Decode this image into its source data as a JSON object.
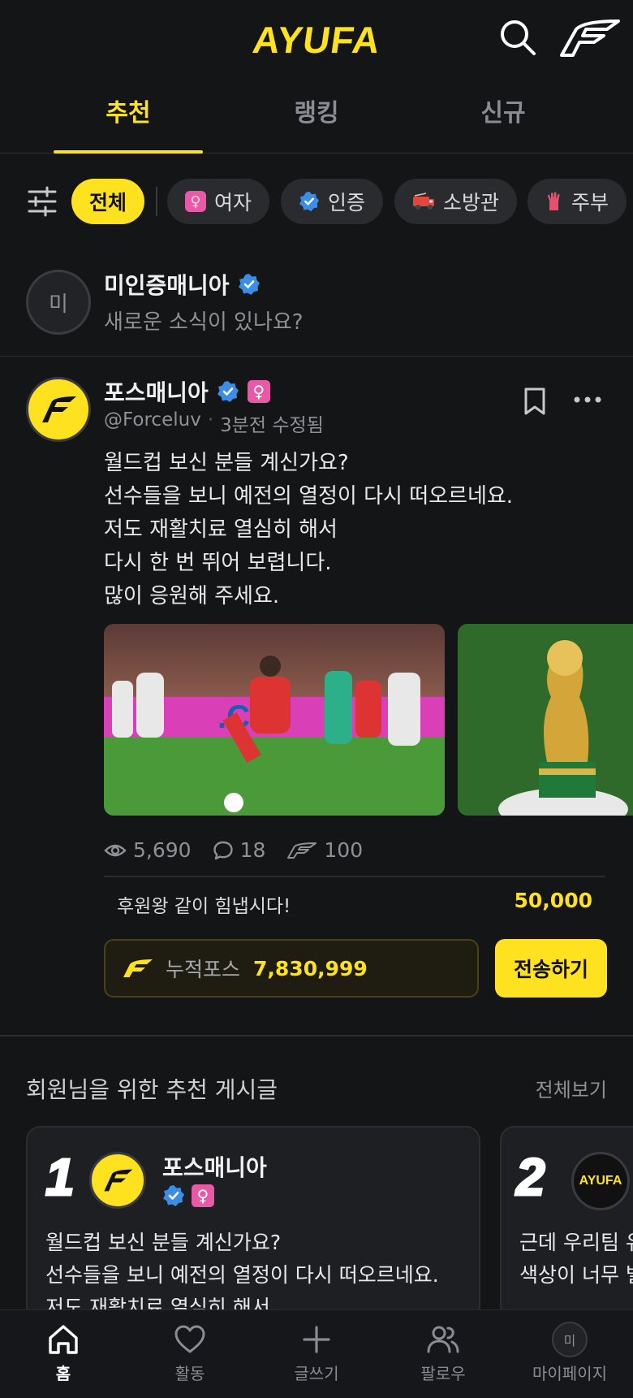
{
  "app": {
    "logo": "AYUFA"
  },
  "header": {
    "search_icon": "search-icon",
    "brand_icon": "force-wing-icon"
  },
  "tabs": [
    {
      "label": "추천",
      "active": true
    },
    {
      "label": "랭킹",
      "active": false
    },
    {
      "label": "신규",
      "active": false
    }
  ],
  "filters": {
    "icon": "sliders-icon",
    "chips": [
      {
        "label": "전체",
        "active": true,
        "icon": ""
      },
      {
        "label": "여자",
        "active": false,
        "icon": "female-icon"
      },
      {
        "label": "인증",
        "active": false,
        "icon": "verified-icon"
      },
      {
        "label": "소방관",
        "active": false,
        "icon": "fire-truck-icon"
      },
      {
        "label": "주부",
        "active": false,
        "icon": "glove-icon"
      }
    ]
  },
  "compose": {
    "avatar_initial": "미",
    "username": "미인증매니아",
    "placeholder": "새로운 소식이 있나요?"
  },
  "post": {
    "author": "포스매니아",
    "handle": "@Forceluv",
    "time": "3분전 수정됨",
    "lines": [
      "월드컵 보신 분들 계신가요?",
      "선수들을 보니 예전의 열정이 다시 떠오르네요.",
      "저도 재활치료 열심히 해서",
      "다시 한 번 뛰어 보렵니다.",
      "많이 응원해 주세요."
    ],
    "views": "5,690",
    "comments": "18",
    "forces": "100",
    "support_label": "후원왕  같이 힘냅시다!",
    "support_amount": "50,000",
    "force_total_label": "누적포스",
    "force_total": "7,830,999",
    "send_label": "전송하기"
  },
  "recommended": {
    "title": "회원님을 위한 추천 게시글",
    "see_all": "전체보기",
    "cards": [
      {
        "rank": "1",
        "author": "포스매니아",
        "line1": "월드컵 보신 분들 계신가요?",
        "line2": "선수들을 보니 예전의 열정이 다시 떠오르네요.",
        "line3": "저도 재활치료 열심히 해서..."
      },
      {
        "rank": "2",
        "author_logo": "AYUFA",
        "line1": "근데 우리팀 유",
        "line2": "색상이 너무 별"
      }
    ]
  },
  "bottom_nav": [
    {
      "label": "홈",
      "icon": "home-icon",
      "active": true
    },
    {
      "label": "활동",
      "icon": "heart-icon",
      "active": false
    },
    {
      "label": "글쓰기",
      "icon": "plus-icon",
      "active": false
    },
    {
      "label": "팔로우",
      "icon": "users-icon",
      "active": false
    },
    {
      "label": "마이페이지",
      "icon": "avatar-icon",
      "active": false,
      "initial": "미"
    }
  ],
  "colors": {
    "accent": "#FFE21F",
    "background": "#141517",
    "verified": "#3a8ee6",
    "female": "#e85aa8"
  }
}
